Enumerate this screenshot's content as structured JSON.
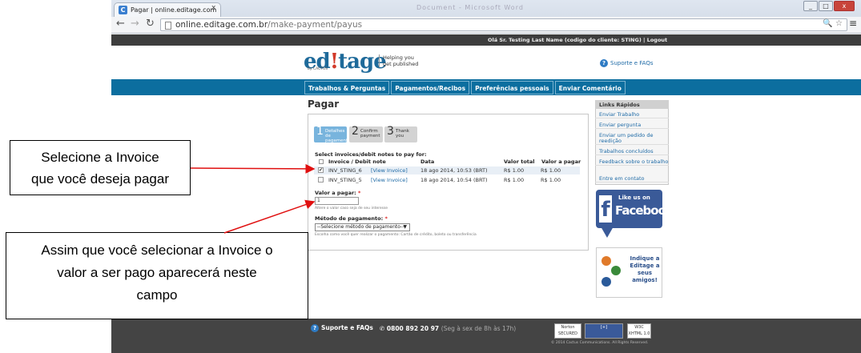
{
  "browser": {
    "tab_title": "Pagar | online.editage.com",
    "tab_close": "x",
    "background_window_text": "Document - Microsoft Word",
    "url_host": "online.editage.com.br",
    "url_path": "/make-payment/payus",
    "window_buttons": [
      "_",
      "□",
      "x"
    ],
    "icons": [
      "back-icon",
      "forward-icon",
      "reload-icon",
      "zoom-icon",
      "star-icon",
      "menu-icon"
    ]
  },
  "site": {
    "user_bar": "Olá Sr. Testing Last Name (codigo do cliente: STING) | Logout",
    "logo_text_1": "ed",
    "logo_bang": "!",
    "logo_text_2": "tage",
    "logo_sub": "by CACTUS",
    "tagline_1": "Helping you",
    "tagline_2": "get published",
    "support_faqs": "Suporte e FAQs",
    "nav": [
      "Trabalhos & Perguntas",
      "Pagamentos/Recibos",
      "Preferências pessoais",
      "Enviar Comentário"
    ],
    "page_title": "Pagar",
    "steps": [
      {
        "num": "1",
        "label": "Detalhes de pagamento"
      },
      {
        "num": "2",
        "label": "Confirm payment"
      },
      {
        "num": "3",
        "label": "Thank you"
      }
    ],
    "select_label": "Select invoices/debit notes to pay for:",
    "table_headers": [
      "Invoice / Debit note",
      "Data",
      "Valor total",
      "Valor a pagar"
    ],
    "rows": [
      {
        "checked": "✔",
        "invoice": "INV_STING_6",
        "view": "[View Invoice]",
        "date": "18 ago 2014, 10:53 (BRT)",
        "total": "R$ 1.00",
        "to_pay": "R$ 1.00"
      },
      {
        "checked": "",
        "invoice": "INV_STING_5",
        "view": "[View Invoice]",
        "date": "18 ago 2014, 10:54 (BRT)",
        "total": "R$ 1.00",
        "to_pay": "R$ 1.00"
      }
    ],
    "amount_label": "Valor a pagar:",
    "required_mark": "*",
    "amount_value": "1",
    "amount_help": "Altere o valor caso seja de seu interesse",
    "method_label": "Método de pagamento:",
    "method_value": "--Selecione método de pagamento--",
    "method_help": "Escolha como você quer realizar o pagamento: Cartão de crédito, boleto ou transferência",
    "quick_links_title": "Links Rápidos",
    "quick_links": [
      "Enviar Trabalho",
      "Enviar pergunta",
      "Enviar um pedido de reedição",
      "Trabalhos concluídos",
      "Feedback sobre o trabalho",
      "Entre em contato"
    ],
    "fb_like": "Like us on",
    "fb_word": "Facebook",
    "fb_f": "f",
    "indique": "Indique a Editage a seus amigos!",
    "footer_support": "Suporte e FAQs",
    "footer_phone": "0800 892 20 97",
    "footer_hours": "(Seg à sex de 8h às 17h)",
    "badges": [
      "Norton SECURED",
      "[+]",
      "W3C XHTML 1.0"
    ],
    "copyright": "© 2014 Cactus Communications. All Rights Reserved."
  },
  "annotations": {
    "callout_1_line_1": "Selecione a Invoice",
    "callout_1_line_2": "que você deseja pagar",
    "callout_2_line_1": "Assim que você selecionar a Invoice o",
    "callout_2_line_2": "valor a ser pago aparecerá neste",
    "callout_2_line_3": "campo",
    "arrow_color": "#e01010"
  }
}
